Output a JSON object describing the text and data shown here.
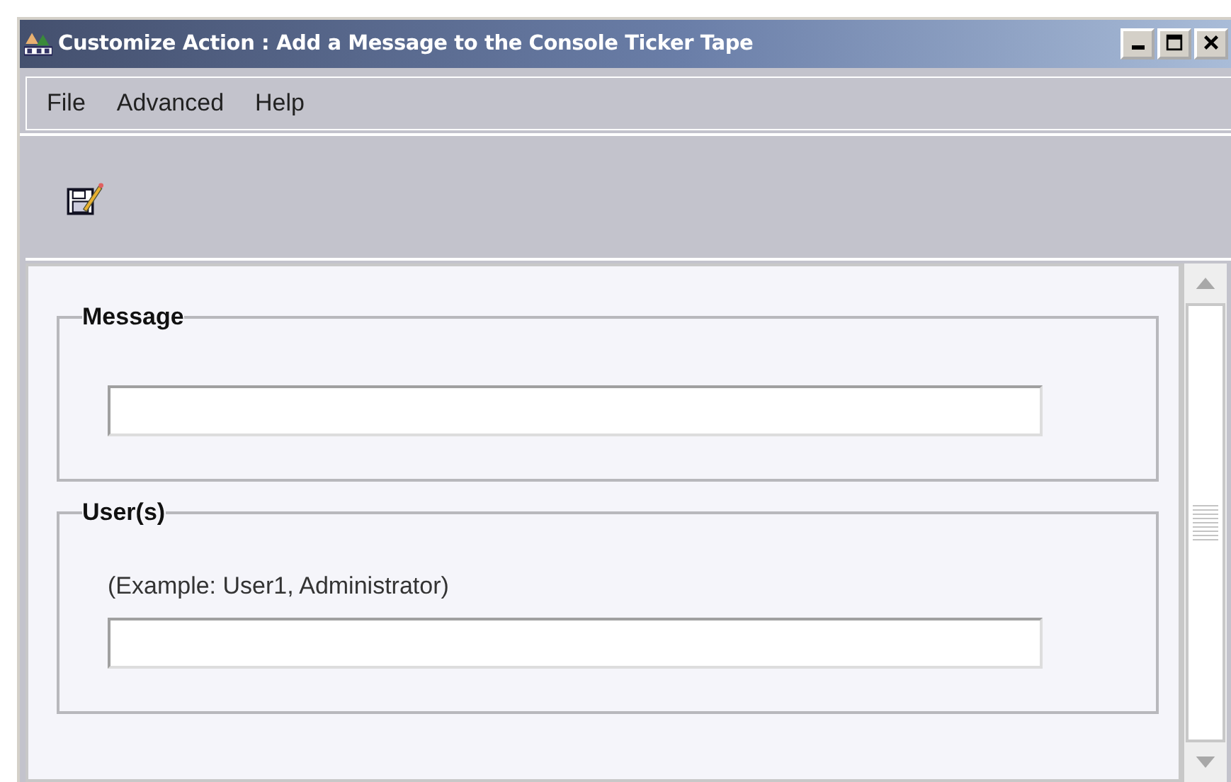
{
  "window": {
    "title": "Customize Action : Add a Message to the Console Ticker Tape"
  },
  "menu": [
    "File",
    "Advanced",
    "Help"
  ],
  "groups": [
    {
      "legend": "Message"
    },
    {
      "legend": "User(s)",
      "hint": "(Example: User1, Administrator)"
    }
  ]
}
